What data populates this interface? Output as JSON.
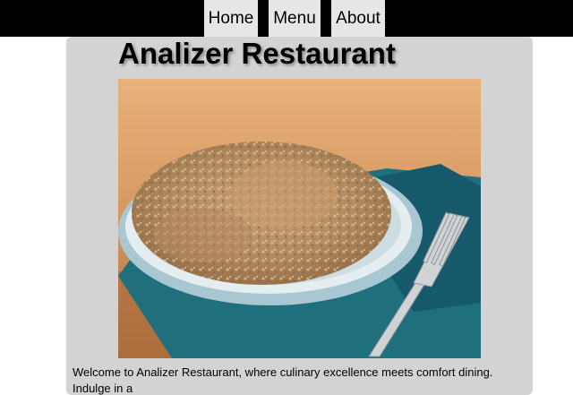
{
  "nav": {
    "items": [
      {
        "label": "Home"
      },
      {
        "label": "Menu"
      },
      {
        "label": "About"
      }
    ]
  },
  "main": {
    "title": "Analizer Restaurant",
    "intro": "Welcome to Analizer Restaurant, where culinary excellence meets comfort dining. Indulge in a"
  },
  "colors": {
    "navbar": "#000000",
    "nav_button": "#e6e6e6",
    "content_bg": "#d3d3d3"
  }
}
